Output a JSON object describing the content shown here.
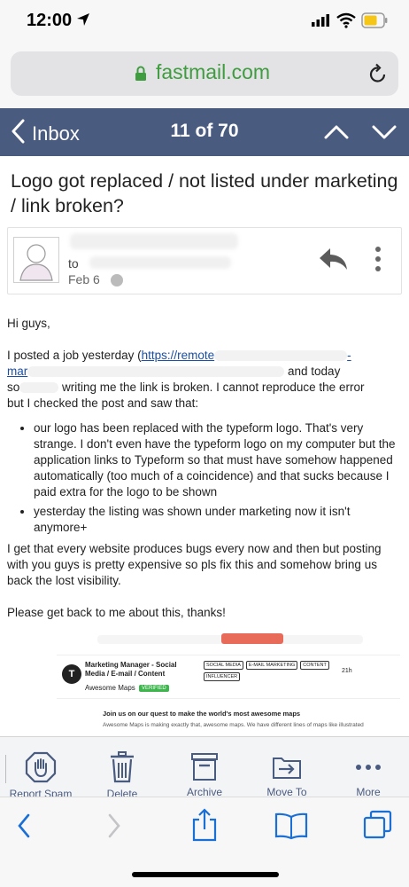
{
  "status_bar": {
    "time": "12:00"
  },
  "browser": {
    "url_domain": "fastmail.com"
  },
  "nav": {
    "back_label": "Inbox",
    "position": "11 of 70"
  },
  "message": {
    "subject": "Logo got replaced / not listed under marketing / link broken?",
    "recipient_prefix": "to",
    "date": "Feb 6",
    "greeting": "Hi guys,",
    "p1_start": "I posted a job yesterday (",
    "p1_link_start": "https://remote",
    "p1_link_end": "-",
    "p1_line2_start": "mar",
    "p1_line2_end": "and today",
    "p1_line3_start": "so",
    "p1_line3_mid": "writing me the link is broken. I cannot reproduce the error",
    "p1_line4": "but I checked the post and saw that:",
    "bullets": [
      "our logo has been replaced with the typeform logo. That's very strange. I don't even have the typeform logo on my computer but the application links to Typeform so that must have somehow happened automatically (too much of a coincidence) and that sucks because I paid extra for the logo to be shown",
      "yesterday the listing was shown under marketing now it isn't anymore+"
    ],
    "p2": "I get that every website produces bugs every now and then but posting with you guys is pretty expensive so pls fix this and somehow bring us back the lost visibility.",
    "p3": "Please get back to me about this, thanks!"
  },
  "preview": {
    "logo_letter": "T",
    "job_title": "Marketing Manager - Social Media / E-mail / Content",
    "company": "Awesome Maps",
    "verified": "VERIFIED",
    "tags": [
      "SOCIAL MEDIA",
      "E-MAIL MARKETING",
      "CONTENT",
      "INFLUENCER"
    ],
    "age": "21h",
    "join_text": "Join us on our quest to make the world's most awesome maps",
    "description": "Awesome Maps is making exactly that, awesome maps. We have different lines of maps like illustrated"
  },
  "toolbar": {
    "report_spam": "Report Spam",
    "delete": "Delete",
    "archive": "Archive",
    "move_to": "Move To",
    "more": "More"
  },
  "colors": {
    "nav_bg": "#4a5b80",
    "accent": "#4a5b80",
    "link": "#1a4fa3",
    "url_green": "#3f9c3f",
    "safari_blue": "#1a6fd6"
  }
}
